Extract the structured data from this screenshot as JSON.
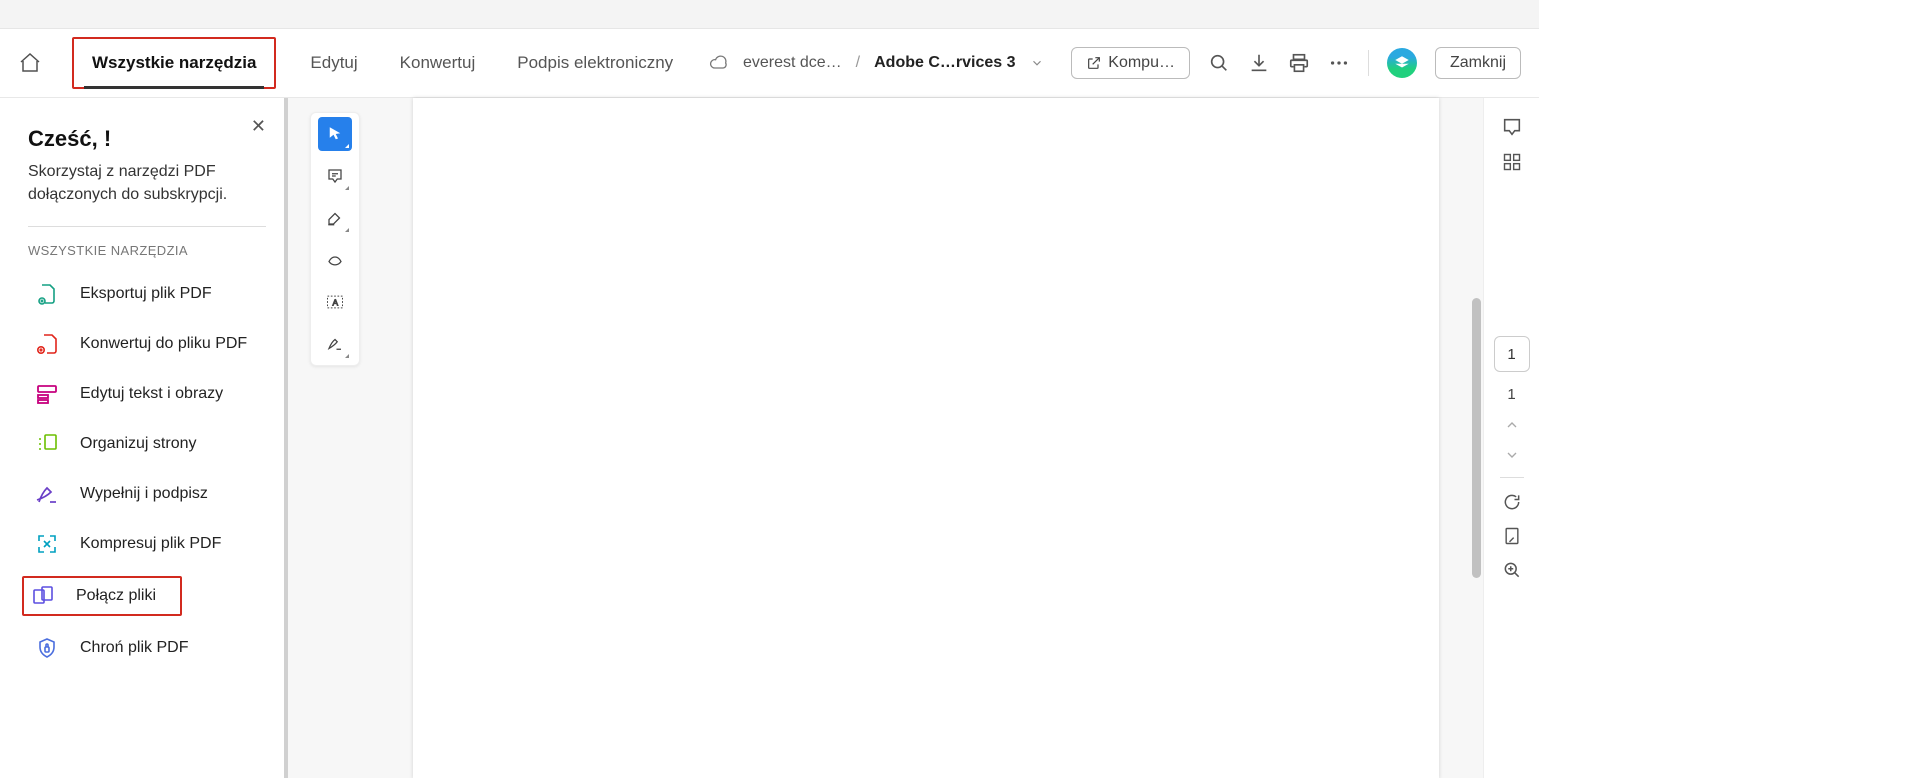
{
  "header": {
    "tabs": {
      "all_tools": "Wszystkie narzędzia",
      "edit": "Edytuj",
      "convert": "Konwertuj",
      "esign": "Podpis elektroniczny"
    },
    "breadcrumb": {
      "cloud_file": "everest dce…",
      "separator": "/",
      "doc_name": "Adobe C…rvices 3"
    },
    "buttons": {
      "share_computer": "Kompu…",
      "close": "Zamknij"
    }
  },
  "sidebar": {
    "greeting": "Cześć, !",
    "subtitle": "Skorzystaj z narzędzi PDF dołączonych do subskrypcji.",
    "group_label": "WSZYSTKIE NARZĘDZIA",
    "tools": [
      {
        "label": "Eksportuj plik PDF"
      },
      {
        "label": "Konwertuj do pliku PDF"
      },
      {
        "label": "Edytuj tekst i obrazy"
      },
      {
        "label": "Organizuj strony"
      },
      {
        "label": "Wypełnij i podpisz"
      },
      {
        "label": "Kompresuj plik PDF"
      },
      {
        "label": "Połącz pliki"
      },
      {
        "label": "Chroń plik PDF"
      }
    ]
  },
  "right_rail": {
    "current_page": "1",
    "total_pages": "1"
  }
}
